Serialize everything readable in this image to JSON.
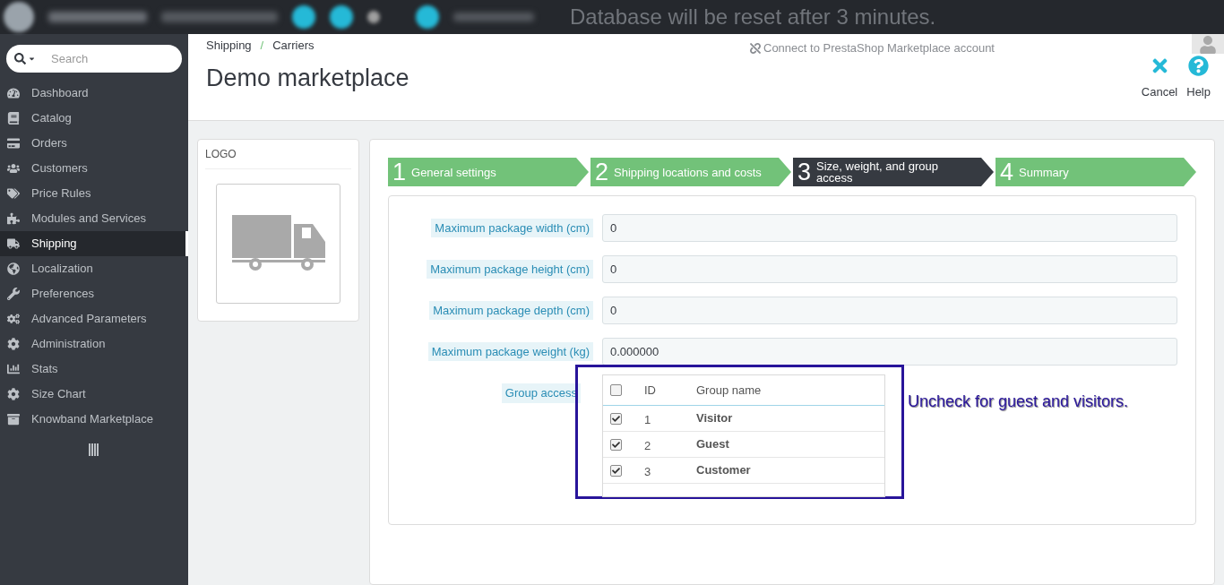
{
  "top_bar": {
    "notice": "Database will be reset after 3 minutes."
  },
  "sidebar": {
    "search": {
      "placeholder": "Search"
    },
    "items": [
      {
        "label": "Dashboard",
        "selected": false
      },
      {
        "label": "Catalog",
        "selected": false
      },
      {
        "label": "Orders",
        "selected": false
      },
      {
        "label": "Customers",
        "selected": false
      },
      {
        "label": "Price Rules",
        "selected": false
      },
      {
        "label": "Modules and Services",
        "selected": false
      },
      {
        "label": "Shipping",
        "selected": true
      },
      {
        "label": "Localization",
        "selected": false
      },
      {
        "label": "Preferences",
        "selected": false
      },
      {
        "label": "Advanced Parameters",
        "selected": false
      },
      {
        "label": "Administration",
        "selected": false
      },
      {
        "label": "Stats",
        "selected": false
      },
      {
        "label": "Size Chart",
        "selected": false
      },
      {
        "label": "Knowband Marketplace",
        "selected": false
      }
    ]
  },
  "header": {
    "breadcrumb": [
      "Shipping",
      "Carriers"
    ],
    "separator": "/",
    "title": "Demo marketplace",
    "marketplace_link": "Connect to PrestaShop Marketplace account",
    "actions": [
      {
        "kind": "cancel",
        "label": "Cancel"
      },
      {
        "kind": "help",
        "label": "Help"
      }
    ]
  },
  "logo_panel": {
    "title": "LOGO"
  },
  "steps": [
    {
      "number": "1",
      "label": "General settings",
      "selected": false
    },
    {
      "number": "2",
      "label": "Shipping locations and costs",
      "selected": false
    },
    {
      "number": "3",
      "label": "Size, weight, and group access",
      "selected": true
    },
    {
      "number": "4",
      "label": "Summary",
      "selected": false
    }
  ],
  "fields": [
    {
      "label": "Maximum package width (cm)",
      "value": "0"
    },
    {
      "label": "Maximum package height (cm)",
      "value": "0"
    },
    {
      "label": "Maximum package depth (cm)",
      "value": "0"
    },
    {
      "label": "Maximum package weight (kg)",
      "value": "0.000000"
    }
  ],
  "group_access": {
    "label": "Group access",
    "columns": [
      "ID",
      "Group name"
    ],
    "all_checked": false,
    "rows": [
      {
        "id": "1",
        "name": "Visitor",
        "checked": true
      },
      {
        "id": "2",
        "name": "Guest",
        "checked": true
      },
      {
        "id": "3",
        "name": "Customer",
        "checked": true
      }
    ]
  },
  "annotation": "Uncheck for guest and visitors."
}
